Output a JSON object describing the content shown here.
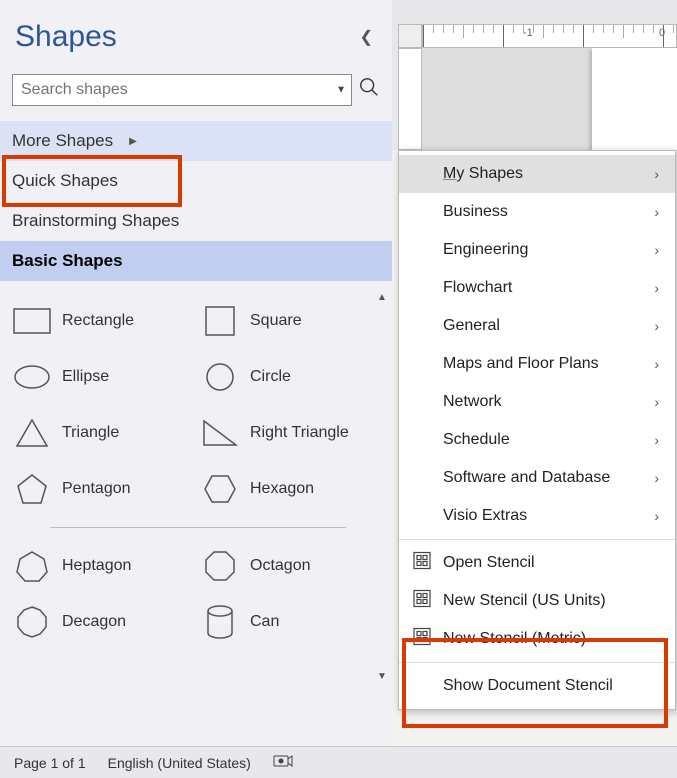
{
  "panel": {
    "title": "Shapes",
    "search_placeholder": "Search shapes"
  },
  "categories": [
    {
      "label": "More Shapes",
      "has_submenu": true,
      "state": "hover"
    },
    {
      "label": "Quick Shapes"
    },
    {
      "label": "Brainstorming Shapes"
    },
    {
      "label": "Basic Shapes",
      "state": "active"
    }
  ],
  "shapes": {
    "group1": [
      {
        "label": "Rectangle",
        "icon": "rect"
      },
      {
        "label": "Square",
        "icon": "square"
      },
      {
        "label": "Ellipse",
        "icon": "ellipse"
      },
      {
        "label": "Circle",
        "icon": "circle"
      },
      {
        "label": "Triangle",
        "icon": "triangle"
      },
      {
        "label": "Right Triangle",
        "icon": "rtriangle"
      },
      {
        "label": "Pentagon",
        "icon": "pentagon"
      },
      {
        "label": "Hexagon",
        "icon": "hexagon"
      }
    ],
    "group2": [
      {
        "label": "Heptagon",
        "icon": "heptagon"
      },
      {
        "label": "Octagon",
        "icon": "octagon"
      },
      {
        "label": "Decagon",
        "icon": "decagon"
      },
      {
        "label": "Can",
        "icon": "can"
      }
    ]
  },
  "ruler": {
    "labels": [
      "-1",
      "0"
    ]
  },
  "flyout": [
    {
      "label": "My Shapes",
      "submenu": true,
      "hover": true,
      "underline_first": true
    },
    {
      "label": "Business",
      "submenu": true
    },
    {
      "label": "Engineering",
      "submenu": true
    },
    {
      "label": "Flowchart",
      "submenu": true
    },
    {
      "label": "General",
      "submenu": true
    },
    {
      "label": "Maps and Floor Plans",
      "submenu": true
    },
    {
      "label": "Network",
      "submenu": true
    },
    {
      "label": "Schedule",
      "submenu": true
    },
    {
      "label": "Software and Database",
      "submenu": true
    },
    {
      "label": "Visio Extras",
      "submenu": true
    },
    {
      "sep": true
    },
    {
      "label": "Open Stencil",
      "icon": "stencil"
    },
    {
      "label": "New Stencil (US Units)",
      "icon": "stencil"
    },
    {
      "label": "New Stencil (Metric)",
      "icon": "stencil"
    },
    {
      "sep": true
    },
    {
      "label": "Show Document Stencil"
    }
  ],
  "status": {
    "page": "Page 1 of 1",
    "lang": "English (United States)"
  }
}
